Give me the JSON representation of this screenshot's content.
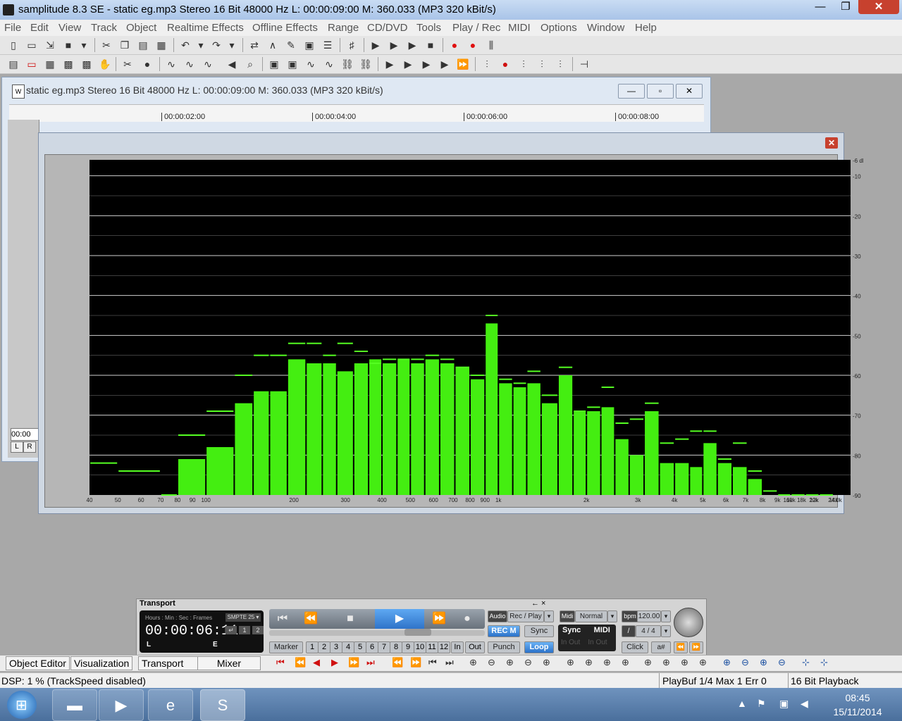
{
  "window": {
    "title": "samplitude 8.3 SE  - static eg.mp3  Stereo 16 Bit 48000 Hz L: 00:00:09:00 M: 360.033  (MP3 320 kBit/s)",
    "min_glyph": "—",
    "max_glyph": "❐",
    "close_glyph": "✕"
  },
  "menu": [
    "File",
    "Edit",
    "View",
    "Track",
    "Object",
    "Realtime Effects",
    "Offline Effects",
    "Range",
    "CD/DVD",
    "Tools",
    "Play / Rec",
    "MIDI",
    "Options",
    "Window",
    "Help"
  ],
  "project_window": {
    "title": "static eg.mp3  Stereo 16 Bit 48000 Hz L: 00:00:09:00 M: 360.033  (MP3 320 kBit/s)",
    "timeline_ticks": [
      "00:00:02:00",
      "00:00:04:00",
      "00:00:06:00",
      "00:00:08:00"
    ],
    "time_box": "00:00",
    "left_btn": "L",
    "right_btn": "R"
  },
  "analyzer": {
    "close_glyph": "✕",
    "colors": {
      "bar": "#44ee11",
      "peak": "#55ff22",
      "background": "#000000",
      "gridline": "#cfcfcf"
    }
  },
  "chart_data": {
    "type": "bar",
    "scale": "log-frequency",
    "x_tick_labels": [
      "40",
      "50",
      "60",
      "70",
      "80",
      "90",
      "100",
      "200",
      "300",
      "400",
      "500",
      "600",
      "700",
      "800",
      "900",
      "1k",
      "2k",
      "3k",
      "4k",
      "5k",
      "6k",
      "7k",
      "8k",
      "9k",
      "10k",
      "12k",
      "14k",
      "16k",
      "18k",
      "20k",
      "24.0k"
    ],
    "y_tick_labels": [
      "-6 dB",
      "-10",
      "-20",
      "-30",
      "-40",
      "-50",
      "-60",
      "-70",
      "-80",
      "-90"
    ],
    "ylim": [
      -90,
      -6
    ],
    "bands": [
      {
        "start": 40,
        "end": 50,
        "level": -90,
        "peak": -82
      },
      {
        "start": 50,
        "end": 70,
        "level": -90,
        "peak": -84
      },
      {
        "start": 70,
        "end": 80,
        "level": -90,
        "peak": -90
      },
      {
        "start": 80,
        "end": 100,
        "level": -81,
        "peak": -75
      },
      {
        "start": 100,
        "end": 125,
        "level": -78,
        "peak": -69
      },
      {
        "start": 125,
        "end": 145,
        "level": -67,
        "peak": -60
      },
      {
        "start": 145,
        "end": 165,
        "level": -64,
        "peak": -55
      },
      {
        "start": 165,
        "end": 190,
        "level": -64,
        "peak": -55
      },
      {
        "start": 190,
        "end": 220,
        "level": -56,
        "peak": -52
      },
      {
        "start": 220,
        "end": 250,
        "level": -57,
        "peak": -52
      },
      {
        "start": 250,
        "end": 280,
        "level": -57,
        "peak": -55
      },
      {
        "start": 280,
        "end": 320,
        "level": -59,
        "peak": -52
      },
      {
        "start": 320,
        "end": 360,
        "level": -57,
        "peak": -54
      },
      {
        "start": 360,
        "end": 400,
        "level": -56,
        "peak": -57
      },
      {
        "start": 400,
        "end": 450,
        "level": -57,
        "peak": -56
      },
      {
        "start": 450,
        "end": 500,
        "level": -56,
        "peak": -56
      },
      {
        "start": 500,
        "end": 560,
        "level": -57,
        "peak": -56
      },
      {
        "start": 560,
        "end": 630,
        "level": -56,
        "peak": -55
      },
      {
        "start": 630,
        "end": 710,
        "level": -57,
        "peak": -56
      },
      {
        "start": 710,
        "end": 800,
        "level": -58,
        "peak": -58
      },
      {
        "start": 800,
        "end": 900,
        "level": -61,
        "peak": -60
      },
      {
        "start": 900,
        "end": 1000,
        "level": -47,
        "peak": -45
      },
      {
        "start": 1000,
        "end": 1120,
        "level": -62,
        "peak": -61
      },
      {
        "start": 1120,
        "end": 1250,
        "level": -63,
        "peak": -62
      },
      {
        "start": 1250,
        "end": 1400,
        "level": -62,
        "peak": -59
      },
      {
        "start": 1400,
        "end": 1600,
        "level": -67,
        "peak": -65
      },
      {
        "start": 1600,
        "end": 1800,
        "level": -60,
        "peak": -58
      },
      {
        "start": 1800,
        "end": 2000,
        "level": -69,
        "peak": -69
      },
      {
        "start": 2000,
        "end": 2240,
        "level": -69,
        "peak": -68
      },
      {
        "start": 2240,
        "end": 2500,
        "level": -68,
        "peak": -63
      },
      {
        "start": 2500,
        "end": 2800,
        "level": -76,
        "peak": -72
      },
      {
        "start": 2800,
        "end": 3150,
        "level": -80,
        "peak": -71
      },
      {
        "start": 3150,
        "end": 3550,
        "level": -69,
        "peak": -67
      },
      {
        "start": 3550,
        "end": 4000,
        "level": -82,
        "peak": -77
      },
      {
        "start": 4000,
        "end": 4500,
        "level": -82,
        "peak": -76
      },
      {
        "start": 4500,
        "end": 5000,
        "level": -83,
        "peak": -74
      },
      {
        "start": 5000,
        "end": 5600,
        "level": -77,
        "peak": -74
      },
      {
        "start": 5600,
        "end": 6300,
        "level": -82,
        "peak": -81
      },
      {
        "start": 6300,
        "end": 7100,
        "level": -83,
        "peak": -77
      },
      {
        "start": 7100,
        "end": 8000,
        "level": -86,
        "peak": -84
      },
      {
        "start": 8000,
        "end": 9000,
        "level": -90,
        "peak": -89
      },
      {
        "start": 9000,
        "end": 10000,
        "level": -90,
        "peak": -90
      },
      {
        "start": 10000,
        "end": 11200,
        "level": -90,
        "peak": -90
      },
      {
        "start": 11200,
        "end": 12500,
        "level": -90,
        "peak": -90
      },
      {
        "start": 12500,
        "end": 14000,
        "level": -90,
        "peak": -90
      }
    ]
  },
  "transport": {
    "title": "Transport",
    "ctrl_glyphs": "←   ×",
    "time_head": "Hours : Min : Sec : Frames",
    "smpte": "SMPTE 25 ▾",
    "time": "00:00:06:11",
    "l_label": "L",
    "e_label": "E",
    "mini_btns": [
      "↵",
      "1",
      "2"
    ],
    "play_glyphs": [
      "⏮",
      "⏪",
      "■",
      "▶",
      "⏩",
      "●"
    ],
    "audio_label": "Audio",
    "rec_play": "Rec / Play",
    "rec_m": "REC M",
    "sync": "Sync",
    "midi_label": "Midi",
    "midi_mode": "Normal",
    "bpm_label": "bpm",
    "bpm": "120.00",
    "sig_label": "/",
    "signature": "4 / 4",
    "sync_midi": "Sync      MIDI",
    "in_out": "In Out    In Out",
    "marker": "Marker",
    "markers": [
      "1",
      "2",
      "3",
      "4",
      "5",
      "6",
      "7",
      "8",
      "9",
      "10",
      "11",
      "12",
      "In",
      "Out"
    ],
    "punch": "Punch",
    "loop": "Loop",
    "click": "Click",
    "hash": "a#",
    "rew": "⏪",
    "ff": "⏩"
  },
  "object_bar": {
    "tabs": [
      "Object Editor",
      "Visualization",
      "Transport",
      "Mixer"
    ]
  },
  "status": {
    "dsp": "DSP: 1 %   (TrackSpeed disabled)",
    "playbuf": "PlayBuf 1/4  Max 1  Err 0",
    "playback": "16 Bit Playback"
  },
  "taskbar": {
    "time": "08:45",
    "date": "15/11/2014"
  }
}
